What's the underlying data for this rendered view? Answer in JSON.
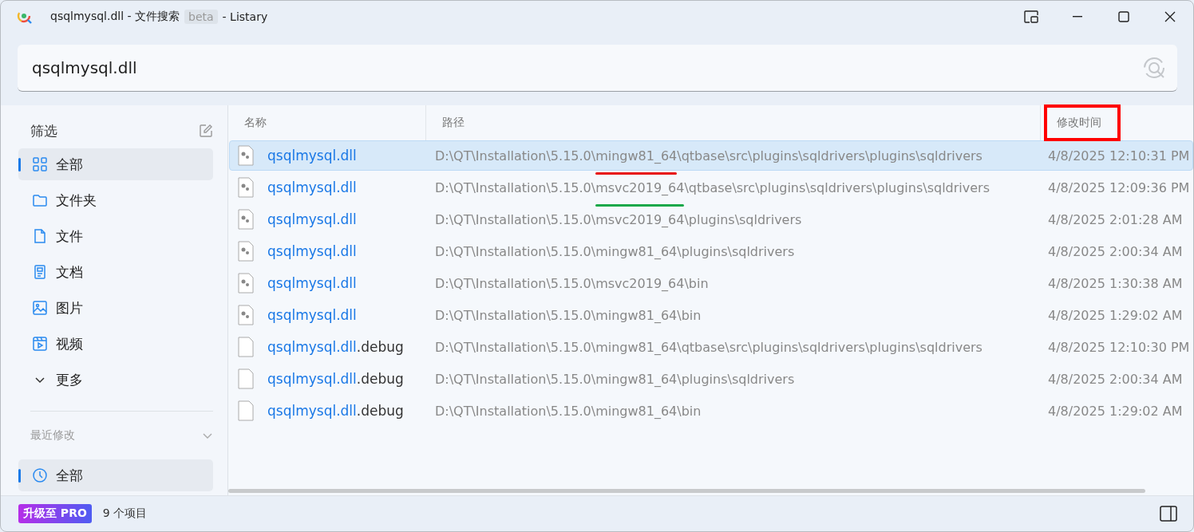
{
  "window": {
    "title_parts": [
      {
        "text": "qsqlmysql.dll - 文件搜索"
      },
      {
        "text": "beta",
        "tag": true
      },
      {
        "text": "- Listary"
      }
    ]
  },
  "search": {
    "value": "qsqlmysql.dll"
  },
  "sidebar": {
    "title": "筛选",
    "items": [
      {
        "label": "全部",
        "selected": true
      },
      {
        "label": "文件夹",
        "selected": false
      },
      {
        "label": "文件",
        "selected": false
      },
      {
        "label": "文档",
        "selected": false
      },
      {
        "label": "图片",
        "selected": false
      },
      {
        "label": "视频",
        "selected": false
      },
      {
        "label": "更多",
        "selected": false
      }
    ],
    "recent": {
      "title": "最近修改",
      "expanded": true,
      "items": [
        {
          "label": "全部",
          "selected": true
        }
      ]
    }
  },
  "table": {
    "columns": [
      {
        "label": "名称"
      },
      {
        "label": "路径"
      },
      {
        "label": "修改时间",
        "color": "#ff0000"
      }
    ],
    "rows": [
      {
        "kind": "dll",
        "name": "qsqlmysql.dll",
        "path": [
          {
            "text": "D:\\QT\\Installation\\5.15.0\\"
          },
          {
            "text": "mingw81_64",
            "color": "#e81010"
          },
          {
            "text": "\\qtbase\\src\\plugins\\sqldrivers\\plugins\\sqldrivers"
          }
        ],
        "time": "4/8/2025 12:10:31 PM",
        "selected": true
      },
      {
        "kind": "dll",
        "name": "qsqlmysql.dll",
        "path": [
          {
            "text": "D:\\QT\\Installation\\5.15.0\\"
          },
          {
            "text": "msvc2019_64",
            "color": "#1aa84a"
          },
          {
            "text": "\\qtbase\\src\\plugins\\sqldrivers\\plugins\\sqldrivers"
          }
        ],
        "time": "4/8/2025 12:09:36 PM",
        "selected": false
      },
      {
        "kind": "dll",
        "name": "qsqlmysql.dll",
        "path": [
          {
            "text": "D:\\QT\\Installation\\5.15.0\\msvc2019_64\\plugins\\sqldrivers"
          }
        ],
        "time": "4/8/2025 2:01:28 AM",
        "selected": false
      },
      {
        "kind": "dll",
        "name": "qsqlmysql.dll",
        "path": [
          {
            "text": "D:\\QT\\Installation\\5.15.0\\mingw81_64\\plugins\\sqldrivers"
          }
        ],
        "time": "4/8/2025 2:00:34 AM",
        "selected": false
      },
      {
        "kind": "dll",
        "name": "qsqlmysql.dll",
        "path": [
          {
            "text": "D:\\QT\\Installation\\5.15.0\\msvc2019_64\\bin"
          }
        ],
        "time": "4/8/2025 1:30:38 AM",
        "selected": false
      },
      {
        "kind": "dll",
        "name": "qsqlmysql.dll",
        "path": [
          {
            "text": "D:\\QT\\Installation\\5.15.0\\mingw81_64\\bin"
          }
        ],
        "time": "4/8/2025 1:29:02 AM",
        "selected": false
      },
      {
        "kind": "plain",
        "name": "qsqlmysql.dll",
        "suffix": ".debug",
        "path": [
          {
            "text": "D:\\QT\\Installation\\5.15.0\\mingw81_64\\qtbase\\src\\plugins\\sqldrivers\\plugins\\sqldrivers"
          }
        ],
        "time": "4/8/2025 12:10:30 PM",
        "selected": false
      },
      {
        "kind": "plain",
        "name": "qsqlmysql.dll",
        "suffix": ".debug",
        "path": [
          {
            "text": "D:\\QT\\Installation\\5.15.0\\mingw81_64\\plugins\\sqldrivers"
          }
        ],
        "time": "4/8/2025 2:00:34 AM",
        "selected": false
      },
      {
        "kind": "plain",
        "name": "qsqlmysql.dll",
        "suffix": ".debug",
        "path": [
          {
            "text": "D:\\QT\\Installation\\5.15.0\\mingw81_64\\bin"
          }
        ],
        "time": "4/8/2025 1:29:02 AM",
        "selected": false
      }
    ]
  },
  "status_bar": {
    "badge": "升级至 PRO",
    "count": "9 个项目"
  }
}
